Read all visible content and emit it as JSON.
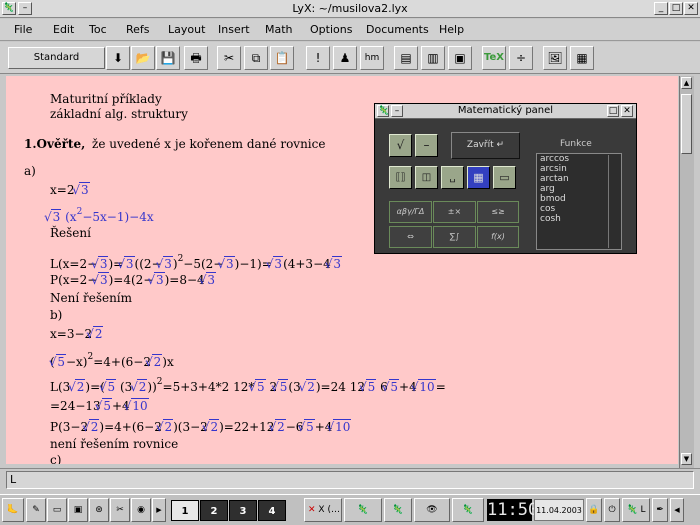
{
  "window": {
    "title": "LyX: ~/musilova2.lyx"
  },
  "menu": [
    "File",
    "Edit",
    "Toc",
    "Refs",
    "Layout",
    "Insert",
    "Math",
    "Options",
    "Documents",
    "Help"
  ],
  "toolbar": {
    "layout_value": "Standard",
    "tex_label": "TeX",
    "hm_label": "hm"
  },
  "document": {
    "lines": [
      "Maturitní příklady",
      "základní alg. struktury",
      "1.Ověřte,",
      "že uvedené x je kořenem dané rovnice",
      "a)",
      "x=2",
      "(x",
      "2",
      "−5x−1)−4x",
      "Řešení",
      "L(x=2−",
      ")=",
      "((2−",
      ")",
      "2",
      "−5(2−",
      ")−1)=",
      "(4+3−4",
      "P(x=2−",
      ")=4(2−",
      ")=8−4",
      "Není řešením",
      "b)",
      "x=3−2",
      "(",
      "−x)",
      "2",
      "=4+(6−2",
      ")x",
      "L(3",
      "2",
      ")=(",
      "(3",
      "2",
      "))",
      "2",
      "=5+3+4*2",
      "12*",
      "2",
      "(3",
      "2",
      ")=24",
      "12",
      "6",
      "+4",
      "=",
      "=24−13",
      "+4",
      "P(3−2",
      ")=4+(6−2",
      ")(3−2",
      ")=22+12",
      "−6",
      "+4",
      "není řešením rovnice",
      "c)"
    ],
    "radicands": [
      "3",
      "5",
      "2",
      "10"
    ]
  },
  "math_panel": {
    "title": "Matematický panel",
    "insert_label": "Zavřít",
    "functions_label": "Funkce",
    "functions": [
      "arccos",
      "arcsin",
      "arctan",
      "arg",
      "bmod",
      "cos",
      "cosh"
    ],
    "symbols": [
      "αβγ/ΓΔ",
      "±×",
      "≤≥",
      "⇔",
      "∑∫",
      "f(x)"
    ]
  },
  "status": {
    "text": "L"
  },
  "taskbar": {
    "pagers": [
      "1",
      "2",
      "3",
      "4"
    ],
    "clock": "11:50",
    "date": "11.04.2003",
    "task1": "X (…",
    "task2": "L"
  }
}
